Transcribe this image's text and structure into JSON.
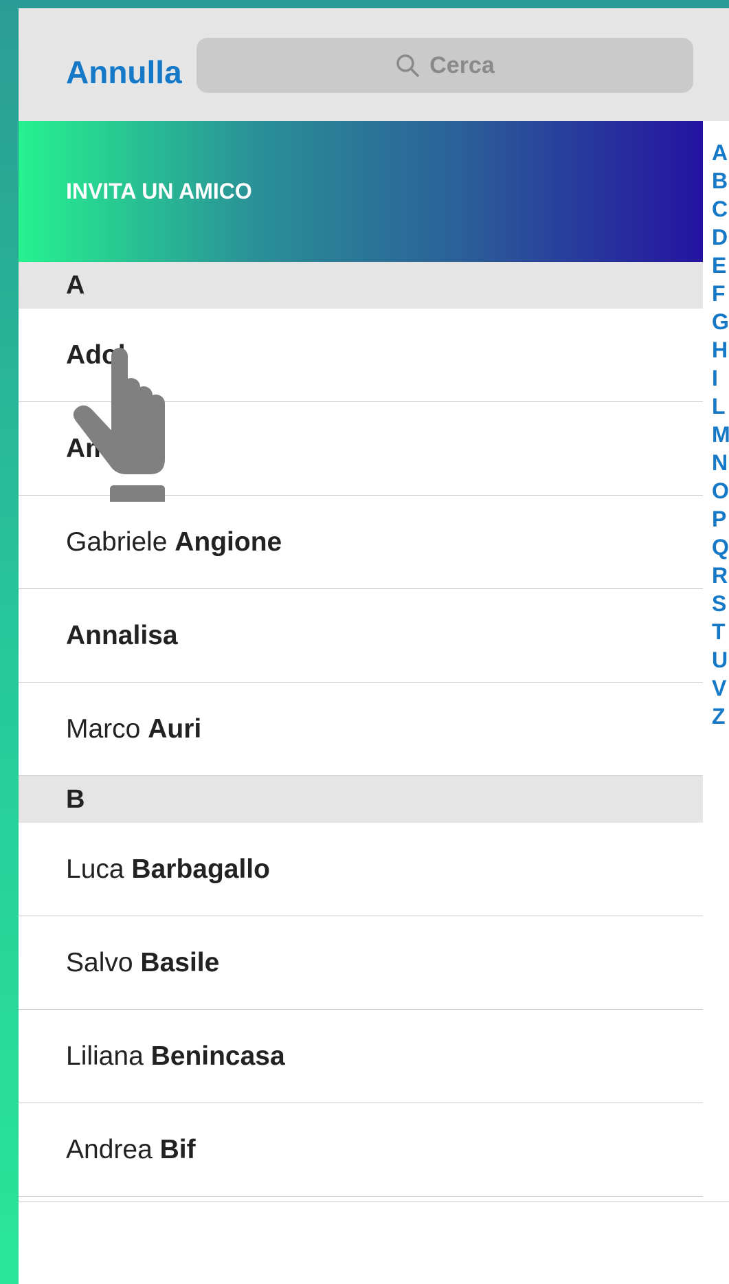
{
  "header": {
    "cancel_label": "Annulla",
    "search": {
      "placeholder": "Cerca",
      "icon": "search-icon"
    }
  },
  "invite": {
    "label": "INVITA UN AMICO"
  },
  "sections": [
    {
      "letter": "A",
      "contacts": [
        {
          "first": "",
          "last": "Adol"
        },
        {
          "first": "",
          "last": "Amore"
        },
        {
          "first": "Gabriele ",
          "last": "Angione"
        },
        {
          "first": "",
          "last": "Annalisa"
        },
        {
          "first": "Marco ",
          "last": "Auri"
        }
      ]
    },
    {
      "letter": "B",
      "contacts": [
        {
          "first": "Luca ",
          "last": "Barbagallo"
        },
        {
          "first": "Salvo ",
          "last": "Basile"
        },
        {
          "first": "Liliana ",
          "last": "Benincasa"
        },
        {
          "first": "Andrea ",
          "last": "Bif"
        }
      ]
    }
  ],
  "index_letters": [
    "A",
    "B",
    "C",
    "D",
    "E",
    "F",
    "G",
    "H",
    "I",
    "L",
    "M",
    "N",
    "O",
    "P",
    "Q",
    "R",
    "S",
    "T",
    "U",
    "V",
    "Z"
  ],
  "colors": {
    "accent": "#1579c8",
    "header_bg": "#e5e5e5",
    "search_bg": "#cacaca",
    "gradient_start": "#26f28f",
    "gradient_end": "#2413a1"
  },
  "overlay": {
    "icon": "pointing-hand-icon"
  }
}
